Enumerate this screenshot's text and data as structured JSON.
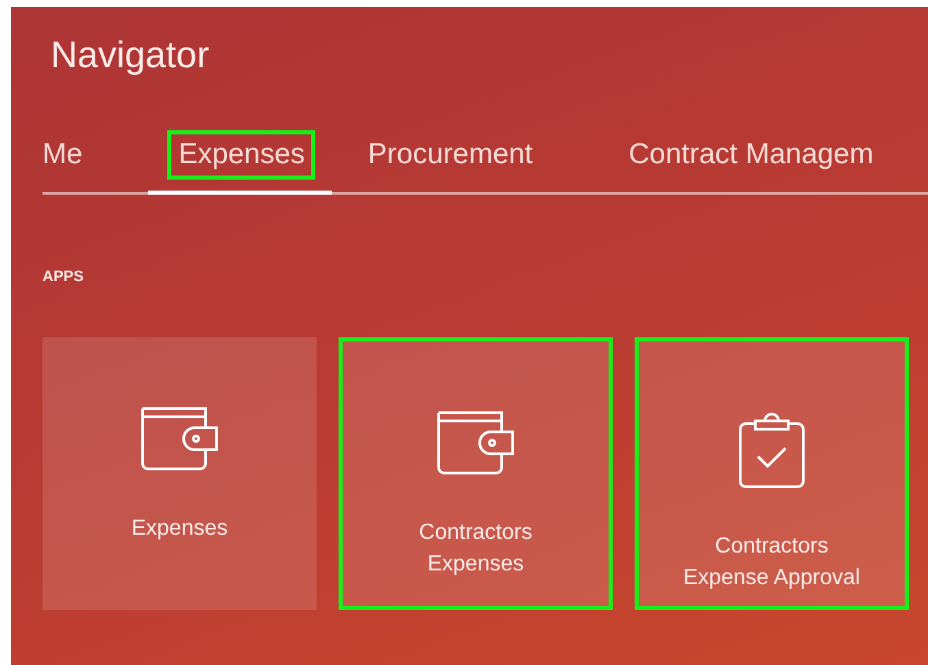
{
  "title": "Navigator",
  "tabs": [
    {
      "label": "Me",
      "selected": false,
      "highlighted": false
    },
    {
      "label": "Expenses",
      "selected": true,
      "highlighted": true
    },
    {
      "label": "Procurement",
      "selected": false,
      "highlighted": false
    },
    {
      "label": "Contract Managem",
      "selected": false,
      "highlighted": false
    }
  ],
  "section_label": "APPS",
  "apps": [
    {
      "label": "Expenses",
      "kind": "wallet",
      "highlighted": false
    },
    {
      "label": "Contractors\nExpenses",
      "kind": "wallet",
      "highlighted": true
    },
    {
      "label": "Contractors\nExpense Approval",
      "kind": "clipboard",
      "highlighted": true
    }
  ]
}
